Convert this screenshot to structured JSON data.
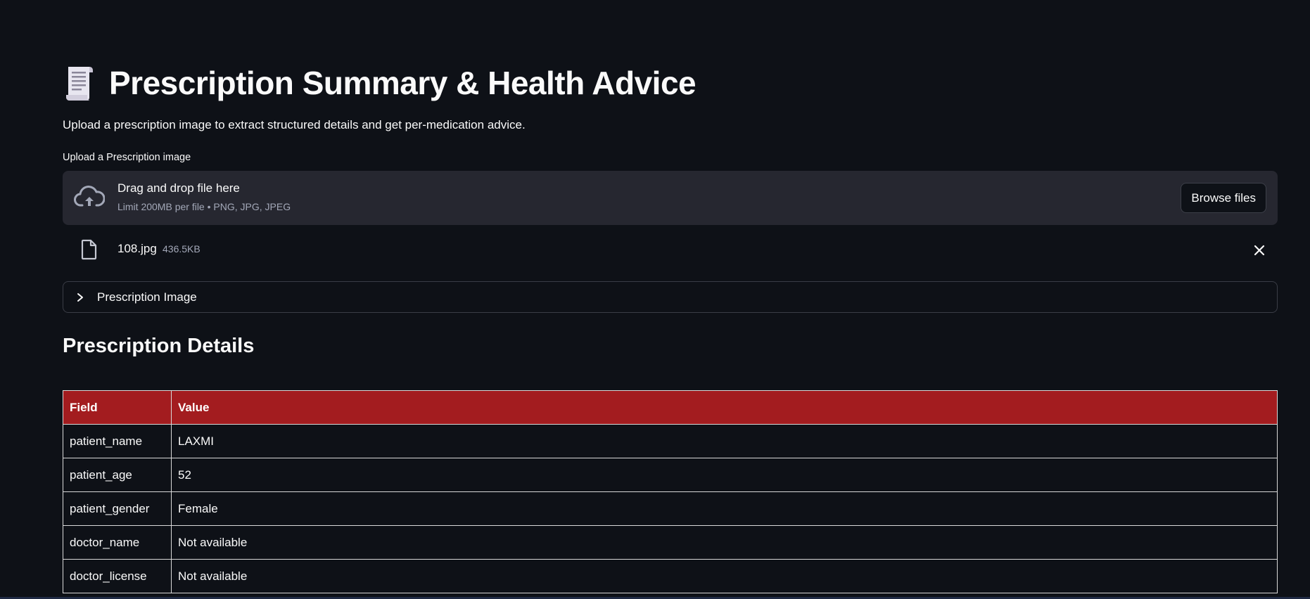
{
  "header": {
    "title": "Prescription Summary & Health Advice",
    "icon": "receipt-icon",
    "subtitle": "Upload a prescription image to extract structured details and get per-medication advice."
  },
  "uploader": {
    "label": "Upload a Prescription image",
    "drop_text": "Drag and drop file here",
    "limit_text": "Limit 200MB per file • PNG, JPG, JPEG",
    "browse_label": "Browse files"
  },
  "uploaded_file": {
    "name": "108.jpg",
    "size": "436.5KB"
  },
  "expander": {
    "label": "Prescription Image"
  },
  "details": {
    "title": "Prescription Details",
    "columns": [
      "Field",
      "Value"
    ],
    "rows": [
      {
        "field": "patient_name",
        "value": "LAXMI"
      },
      {
        "field": "patient_age",
        "value": "52"
      },
      {
        "field": "patient_gender",
        "value": "Female"
      },
      {
        "field": "doctor_name",
        "value": "Not available"
      },
      {
        "field": "doctor_license",
        "value": "Not available"
      }
    ]
  },
  "colors": {
    "background": "#0e1117",
    "dropzone": "#262730",
    "table_header": "#a31c1f",
    "text": "#fafafa",
    "muted": "#a3a8b8"
  }
}
